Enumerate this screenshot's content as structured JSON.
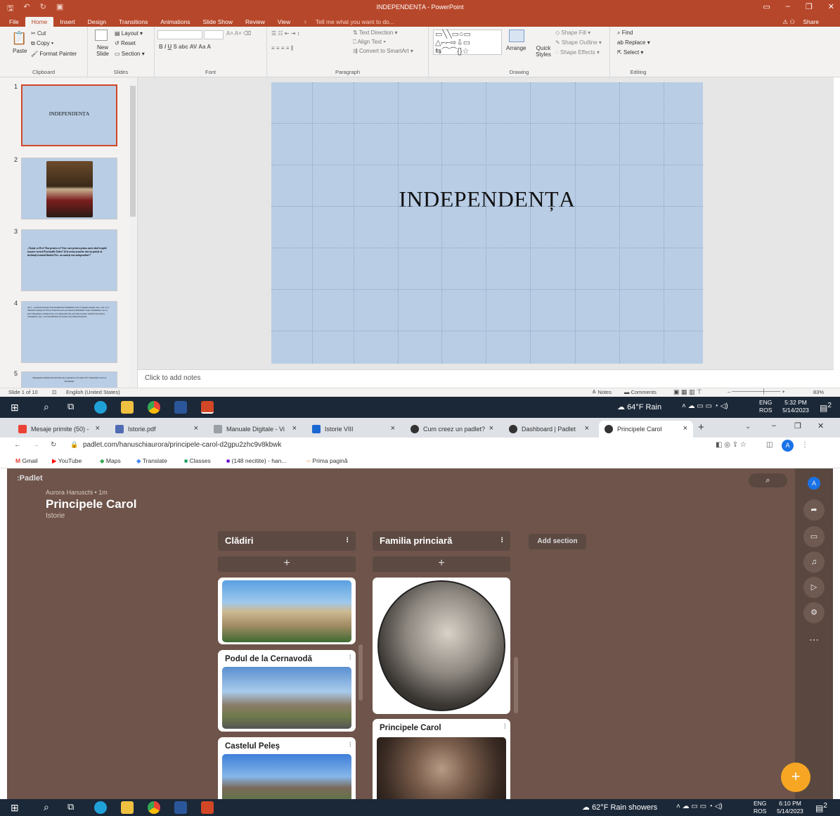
{
  "ppt": {
    "title": "INDEPENDENȚA - PowerPoint",
    "tabs": [
      "File",
      "Home",
      "Insert",
      "Design",
      "Transitions",
      "Animations",
      "Slide Show",
      "Review",
      "View"
    ],
    "tell_me": "Tell me what you want to do...",
    "share": "Share",
    "ribbon": {
      "cut": "Cut",
      "copy": "Copy",
      "format_painter": "Format Painter",
      "paste": "Paste",
      "clipboard": "Clipboard",
      "new_slide": "New Slide",
      "layout": "Layout",
      "reset": "Reset",
      "section": "Section",
      "slides": "Slides",
      "font": "Font",
      "text_direction": "Text Direction",
      "align_text": "Align Text",
      "convert_smartart": "Convert to SmartArt",
      "paragraph": "Paragraph",
      "arrange": "Arrange",
      "quick_styles": "Quick Styles",
      "shape_fill": "Shape Fill",
      "shape_outline": "Shape Outline",
      "shape_effects": "Shape Effects",
      "drawing": "Drawing",
      "find": "Find",
      "replace": "Replace",
      "select": "Select",
      "editing": "Editing"
    },
    "thumbnails": [
      {
        "num": "1",
        "text": "INDEPENDENȚA"
      },
      {
        "num": "2",
        "text": ""
      },
      {
        "num": "3",
        "text": "„Tratat cu Dvs? Dar pentru ce? Este care pentru prima oară când trupele noastre cerură Provinciile Unite? Şi la urma armelor nici nu puteți să încheiați tratatul fiindcă Dvs. nu sunteți stat independent!”"
      },
      {
        "num": "4",
        "text": "Art.1. „Guvernul Alteței Sale Domnitorul României Carol I asigură armatei ruse, care va fi chemată a merge în Turcia, liberă trecere pe teritoriul României. Toate cheltuielile care ar privi întreținerea armatei ruse, de transportul său, precum și pentru satisfacerea tuturor trebuințelor sale, cad naturalmente în sarcina Guvernului Imperial."
      },
      {
        "num": "5",
        "text": "Telegrama trimisă ducelui Nicolae adresată la 19 iulie 1877 prințului Carol al României"
      }
    ],
    "slide_title": "INDEPENDENȚA",
    "notes_placeholder": "Click to add notes",
    "status": {
      "slide_info": "Slide 1 of 10",
      "language": "English (United States)",
      "notes": "Notes",
      "comments": "Comments",
      "zoom": "83%"
    }
  },
  "taskbar1": {
    "weather": "64°F Rain",
    "lang1": "ENG",
    "lang2": "ROS",
    "time": "5:32 PM",
    "date": "5/14/2023",
    "notif": "2"
  },
  "chrome": {
    "tabs": [
      {
        "label": "Mesaje primite (50) -",
        "color": "#ea4335"
      },
      {
        "label": "Istorie.pdf",
        "color": "#4f6bb3"
      },
      {
        "label": "Manuale Digitale - Vi",
        "color": "#9aa0a6"
      },
      {
        "label": "Istorie VIII",
        "color": "#1967d2"
      },
      {
        "label": "Cum creez un padlet?",
        "color": "#333"
      },
      {
        "label": "Dashboard | Padlet",
        "color": "#333"
      },
      {
        "label": "Principele Carol",
        "color": "#333"
      }
    ],
    "url": "padlet.com/hanuschiaurora/principele-carol-d2gpu2zhc9v8kbwk",
    "bookmarks": [
      "Gmail",
      "YouTube",
      "Maps",
      "Translate",
      "Classes",
      "(148 necitite) - han...",
      "Prima pagină"
    ]
  },
  "padlet": {
    "logo": ":Padlet",
    "author": "Aurora Hanuschi",
    "time_ago": "1m",
    "title": "Principele Carol",
    "subtitle": "Istorie",
    "avatar": "A",
    "sections": [
      {
        "name": "Clădiri",
        "posts": [
          "",
          "Podul de la Cernavodă",
          "Castelul Peleș"
        ]
      },
      {
        "name": "Familia princiară",
        "posts": [
          "",
          "Principele Carol"
        ]
      }
    ],
    "add_section": "Add section"
  },
  "taskbar2": {
    "weather": "62°F Rain showers",
    "lang1": "ENG",
    "lang2": "ROS",
    "time": "6:10 PM",
    "date": "5/14/2023",
    "notif": "2"
  }
}
